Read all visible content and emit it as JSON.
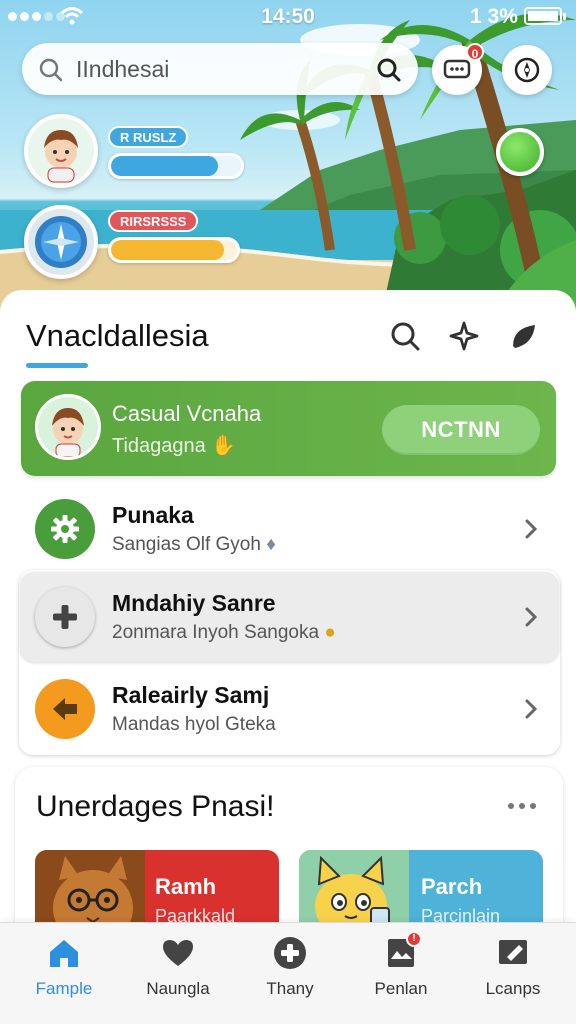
{
  "status_bar": {
    "time": "14:50",
    "battery_percent": "1 3%",
    "wifi_icon": "wifi-icon",
    "signal_icon": "signal-dots-icon"
  },
  "search": {
    "value": "IIndhesai",
    "lead_icon": "search-icon",
    "trail_icon": "search-icon"
  },
  "header_actions": {
    "messages_badge": "0",
    "messages_icon": "chat-bubble-icon",
    "compass_icon": "compass-icon"
  },
  "hero": {
    "profile_one": {
      "label": "R RUSLZ",
      "label_color": "#3fa7e0",
      "bar_color": "#3fa7e0",
      "bar_fill": 0.82
    },
    "profile_two": {
      "label": "RIRSRSSS",
      "label_color": "#e2555b",
      "bar_color": "#f5b731",
      "bar_fill": 0.9
    },
    "status_dot_color": "#3fae2a"
  },
  "section": {
    "title": "Vnacldallesia",
    "icons": [
      "search-icon",
      "sparkle-icon",
      "leaf-icon"
    ]
  },
  "featured": {
    "name": "Casual Vcnaha",
    "subtitle": "Tidagagna",
    "button": "NCTNN",
    "accent": "#5aa63f"
  },
  "list": [
    {
      "title": "Punaka",
      "subtitle": "Sangias Olf Gyoh",
      "icon": "gear-icon",
      "icon_bg": "#4a9d3b"
    },
    {
      "title": "Mndahiy Sanre",
      "subtitle": "2onmara Inyoh Sangoka",
      "icon": "plus-icon",
      "icon_bg": "#e7e7e7"
    },
    {
      "title": "Raleairly Samj",
      "subtitle": "Mandas hyol Gteka",
      "icon": "arrow-left-icon",
      "icon_bg": "#f39a1f"
    }
  ],
  "upcoming": {
    "title": "Unerdages Pnasi!",
    "cards": [
      {
        "title": "Ramh",
        "subtitle": "Paarkkald",
        "color": "#d9312e"
      },
      {
        "title": "Parch",
        "subtitle": "Parcinlain",
        "color": "#4fb2d8"
      }
    ]
  },
  "bottom_nav": [
    {
      "label": "Fample",
      "icon": "home-icon",
      "active": true
    },
    {
      "label": "Naungla",
      "icon": "heart-icon",
      "active": false
    },
    {
      "label": "Thany",
      "icon": "plus-circle-icon",
      "active": false
    },
    {
      "label": "Penlan",
      "icon": "inbox-icon",
      "active": false,
      "badge": "!"
    },
    {
      "label": "Lcanps",
      "icon": "image-edit-icon",
      "active": false
    }
  ]
}
